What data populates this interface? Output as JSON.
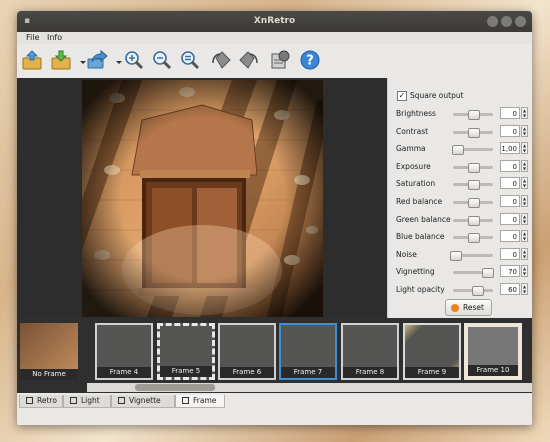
{
  "window": {
    "title": "XnRetro"
  },
  "menu": {
    "items": [
      "File",
      "Info"
    ]
  },
  "toolbar": {
    "tools": [
      "open-icon",
      "save-icon",
      "share-icon",
      "zoom-in-icon",
      "zoom-out-icon",
      "zoom-fit-icon",
      "rotate-left-icon",
      "rotate-right-icon",
      "compare-icon",
      "help-icon"
    ]
  },
  "panel": {
    "square_output": {
      "label": "Square output",
      "checked": true
    },
    "sliders": [
      {
        "label": "Brightness",
        "value": "0",
        "level": 0.5
      },
      {
        "label": "Contrast",
        "value": "0",
        "level": 0.5
      },
      {
        "label": "Gamma",
        "value": "1,00",
        "level": 0.1
      },
      {
        "label": "Exposure",
        "value": "0",
        "level": 0.5
      },
      {
        "label": "Saturation",
        "value": "0",
        "level": 0.5
      },
      {
        "label": "Red balance",
        "value": "0",
        "level": 0.5
      },
      {
        "label": "Green balance",
        "value": "0",
        "level": 0.5
      },
      {
        "label": "Blue balance",
        "value": "0",
        "level": 0.5
      },
      {
        "label": "Noise",
        "value": "0",
        "level": 0.05
      },
      {
        "label": "Vignetting",
        "value": "70",
        "level": 0.85
      },
      {
        "label": "Light opacity",
        "value": "60",
        "level": 0.6
      }
    ],
    "reset_label": "Reset"
  },
  "frames": {
    "items": [
      "No Frame",
      "Frame 4",
      "Frame 5",
      "Frame 6",
      "Frame 7",
      "Frame 8",
      "Frame 9",
      "Frame 10"
    ],
    "selected": "Frame 7"
  },
  "tabs": {
    "items": [
      "Retro",
      "Light",
      "Vignette",
      "Frame"
    ],
    "active": "Frame"
  },
  "colors": {
    "selection": "#3d8fd6",
    "reset_icon": "#e8821c"
  }
}
